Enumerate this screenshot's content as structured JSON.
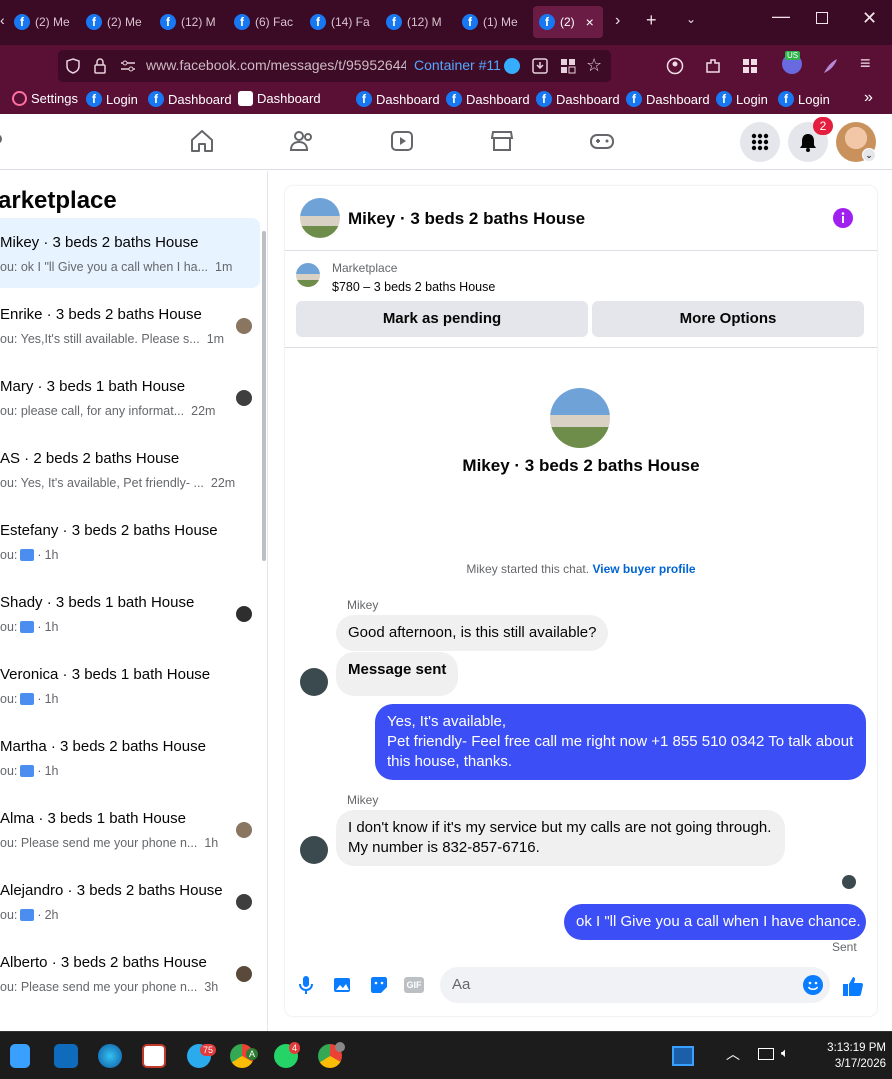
{
  "browser": {
    "tabs": [
      "(2) Me",
      "(2) Me",
      "(12) M",
      "(6) Fac",
      "(14) Fa",
      "(12) M",
      "(1) Me",
      "(2)"
    ],
    "active_tab_close": "×",
    "new_tab": "+",
    "url": "www.facebook.com/messages/t/95952644",
    "container_label": "Container #11",
    "ext_badge": "US",
    "bookmarks": [
      "Settings",
      "Login",
      "Dashboard",
      "Dashboard",
      "Dashboard",
      "Dashboard",
      "Dashboard",
      "Dashboard",
      "Login",
      "Login"
    ],
    "more": "»"
  },
  "fbnav": {
    "notification_count": "2"
  },
  "sidebar": {
    "title": "arketplace",
    "conversations": [
      {
        "title": "Mikey · 3 beds 2 baths House",
        "preview": "ou: ok I \"ll Give you a call when I ha...",
        "time": "1m",
        "selected": true
      },
      {
        "title": "Enrike · 3 beds 2 baths House",
        "preview": "ou: Yes,It's still available. Please s...",
        "time": "1m"
      },
      {
        "title": "Mary · 3 beds 1 bath House",
        "preview": "ou: please call, for any informat...",
        "time": "22m"
      },
      {
        "title": "AS · 2 beds 2 baths House",
        "preview": "ou: Yes, It's available, Pet friendly- ...",
        "time": "22m"
      },
      {
        "title": "Estefany · 3 beds 2 baths House",
        "preview": "ou:",
        "time": "1h"
      },
      {
        "title": "Shady · 3 beds 1 bath House",
        "preview": "ou:",
        "time": "1h"
      },
      {
        "title": "Veronica · 3 beds 1 bath House",
        "preview": "ou:",
        "time": "1h"
      },
      {
        "title": "Martha · 3 beds 2 baths House",
        "preview": "ou:",
        "time": "1h"
      },
      {
        "title": "Alma · 3 beds 1 bath House",
        "preview": "ou: Please send me your phone n...",
        "time": "1h"
      },
      {
        "title": "Alejandro · 3 beds 2 baths House",
        "preview": "ou:",
        "time": "2h"
      },
      {
        "title": "Alberto · 3 beds 2 baths House",
        "preview": "ou: Please send me your phone n...",
        "time": "3h"
      }
    ]
  },
  "chat": {
    "header_title": "Mikey · 3 beds 2 baths House",
    "listing_label": "Marketplace",
    "listing_price": "$780 – 3 beds 2 baths House",
    "mark_pending": "Mark as pending",
    "more_options": "More Options",
    "profile_title": "Mikey · 3 beds 2 baths House",
    "started_text": "Mikey started this chat.",
    "view_buyer": "View buyer profile",
    "sender1": "Mikey",
    "msg1": "Good afternoon, is this still available?",
    "msg2": "Message sent",
    "msg3_line1": "Yes, It's available,",
    "msg3_line2": "Pet friendly- Feel free call me right now +1 855 510 0342 To talk about this house, thanks.",
    "sender2": "Mikey",
    "msg4": "I don't know if it's my service but my calls are not going through. My number is 832-857-6716.",
    "msg5": "ok I \"ll Give you a call when I have chance.",
    "sent_label": "Sent",
    "composer_placeholder": "Aa",
    "gif_label": "GIF"
  },
  "taskbar": {
    "telegram_badge": "75",
    "chrome_badge": "A",
    "whatsapp_badge": "4",
    "time": "3:13:19 PM",
    "date": "3/17/2026"
  }
}
